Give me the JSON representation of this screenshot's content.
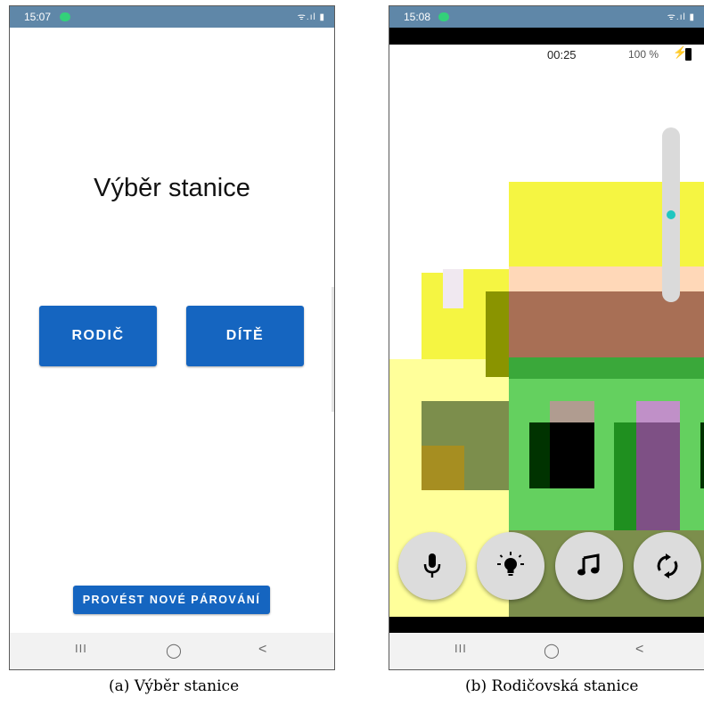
{
  "left_screen": {
    "status_time": "15:07",
    "status_icons": "ᯤ.ıl ▮",
    "title": "Výběr stanice",
    "parent_button": "RODIČ",
    "child_button": "DÍTĚ",
    "pair_button": "PROVÉST NOVÉ PÁROVÁNÍ",
    "nav_recent": "III",
    "nav_home": "◯",
    "nav_back": "<"
  },
  "right_screen": {
    "status_time": "15:08",
    "status_icons": "ᯤ.ıl ▮",
    "elapsed_time": "00:25",
    "battery_percent": "100 %",
    "volume_level": 0.5,
    "nav_recent": "III",
    "nav_home": "◯",
    "nav_back": "<",
    "controls": [
      {
        "name": "microphone-button",
        "icon": "microphone-icon"
      },
      {
        "name": "light-button",
        "icon": "lightbulb-icon"
      },
      {
        "name": "music-button",
        "icon": "music-note-icon"
      },
      {
        "name": "switch-camera-button",
        "icon": "refresh-icon"
      }
    ]
  },
  "captions": {
    "left": "(a) Výběr stanice",
    "right": "(b) Rodičovská stanice"
  }
}
